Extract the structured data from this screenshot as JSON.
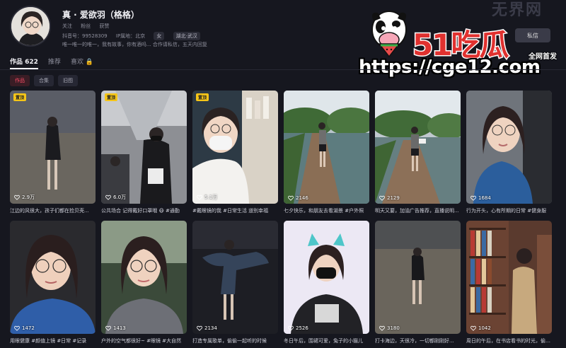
{
  "profile": {
    "name": "真 · 爱欲羽（格格）",
    "line1": [
      "关注",
      "粉丝",
      "获赞"
    ],
    "line2_id": "抖音号：99528309",
    "line2_ip": "IP属地：北京",
    "tags": [
      "女",
      "湖北·武汉"
    ],
    "bio": "唯一唯一的唯一，我有故事，你有酒吗... 合作请私信，五天内回复"
  },
  "ghost_text": "无界网",
  "watermark": {
    "brand": "51吃瓜",
    "subline": "全网首发",
    "url": "https://cge12.com"
  },
  "follow_button": "私信",
  "tabs": [
    {
      "label": "作品 622",
      "active": true
    },
    {
      "label": "推荐",
      "active": false
    },
    {
      "label": "喜欢 🔒",
      "active": false
    }
  ],
  "filters": [
    {
      "label": "作品",
      "active": true
    },
    {
      "label": "合集",
      "active": false
    },
    {
      "label": "旧图",
      "active": false
    }
  ],
  "pin_label": "置顶",
  "colors": {
    "accent": "#ff4d67",
    "pin": "#f5c518",
    "bg": "#16171f"
  },
  "videos": [
    {
      "likes": "2.9万",
      "caption": "江边的风很大，孩子们都在捡贝壳...",
      "pinned": true,
      "scene": "beach-night"
    },
    {
      "likes": "6.0万",
      "caption": "公共场合 记得戴好口罩哦 😷 #通勤",
      "pinned": true,
      "scene": "train"
    },
    {
      "likes": "5.1万",
      "caption": "#戴眼镜的我 #日常生活 道别幸福",
      "pinned": true,
      "scene": "shop-selfie"
    },
    {
      "likes": "2146",
      "caption": "七夕快乐，和朋友去看湖景 #户外照",
      "pinned": false,
      "scene": "lake"
    },
    {
      "likes": "2129",
      "caption": "明天又要，加油广告推荐，直播说明...",
      "pinned": false,
      "scene": "lake2"
    },
    {
      "likes": "1684",
      "caption": "行为开头，心有所期的日常 #健身服",
      "pinned": false,
      "scene": "car-selfie"
    },
    {
      "likes": "1472",
      "caption": "用眼健康 #颜值上镜 #日常 #记录",
      "pinned": false,
      "scene": "glasses-portrait"
    },
    {
      "likes": "1413",
      "caption": "户外的空气都很好~ #眼镜 #大自然",
      "pinned": false,
      "scene": "outdoor-portrait"
    },
    {
      "likes": "2134",
      "caption": "打造专属歌单，偷偷一起听的时候",
      "pinned": false,
      "scene": "dark-dance"
    },
    {
      "likes": "2526",
      "caption": "冬日午后，围裙可爱，兔子的小猫儿",
      "pinned": false,
      "scene": "cat-ears"
    },
    {
      "likes": "3180",
      "caption": "打卡海边，天很冷，一切都刚刚好...",
      "pinned": false,
      "scene": "beach-walk"
    },
    {
      "likes": "1042",
      "caption": "周日的午后，在书店看书的时光，偷得...",
      "pinned": false,
      "scene": "bookstore"
    }
  ]
}
